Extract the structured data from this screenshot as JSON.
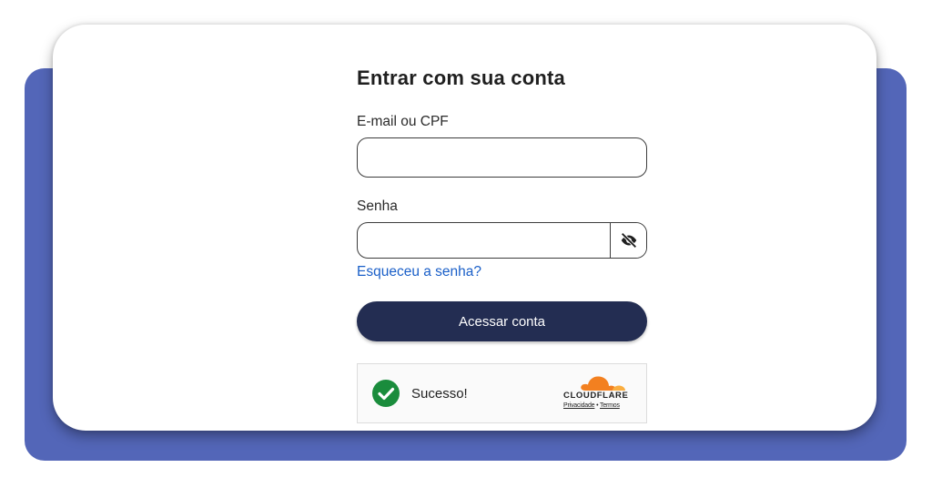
{
  "login": {
    "title": "Entrar com sua conta",
    "email": {
      "label": "E-mail ou CPF",
      "value": "",
      "placeholder": ""
    },
    "password": {
      "label": "Senha",
      "value": "",
      "placeholder": "",
      "toggle_icon": "eye-off-icon"
    },
    "forgot_link": "Esqueceu a senha?",
    "submit_label": "Acessar conta"
  },
  "captcha": {
    "status_icon": "check-circle-icon",
    "status_text": "Sucesso!",
    "brand": "CLOUDFLARE",
    "privacy_link": "Privacidade",
    "separator": "•",
    "terms_link": "Termos"
  },
  "colors": {
    "backdrop": "#5366b8",
    "primary_button": "#232d52",
    "link": "#1a5fc8",
    "success": "#1a8c3c",
    "cloudflare_orange": "#f38020"
  }
}
